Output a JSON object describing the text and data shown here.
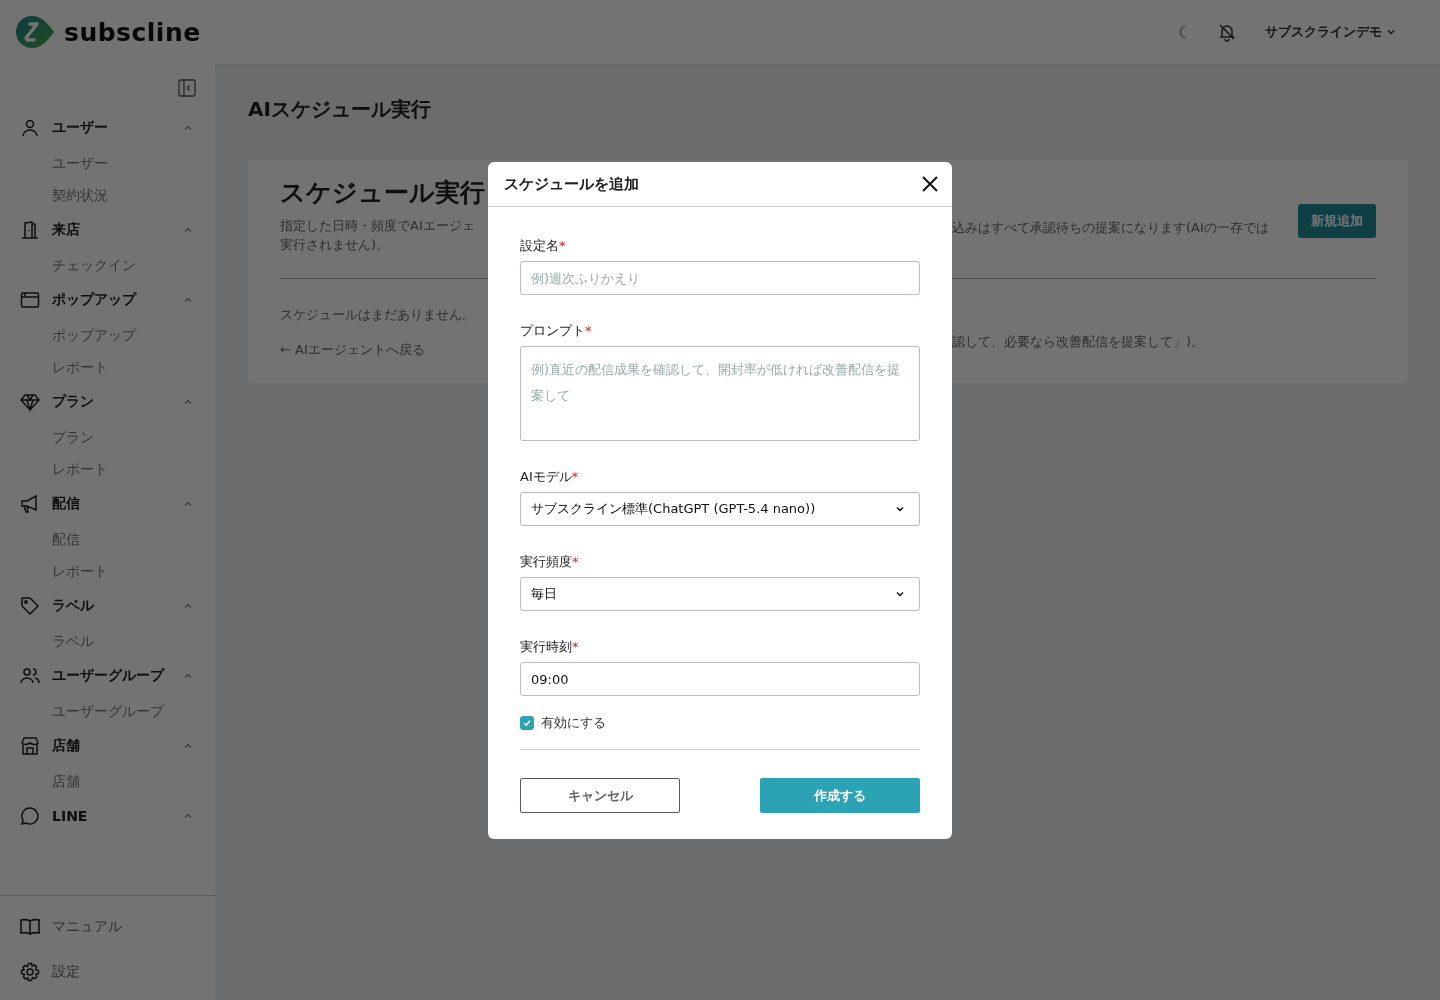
{
  "header": {
    "logo_text": "subscline",
    "account": "サブスクラインデモ"
  },
  "sidebar": {
    "groups": [
      {
        "kind": "user",
        "label": "ユーザー",
        "expanded": true,
        "children": [
          {
            "label": "ユーザー"
          },
          {
            "label": "契約状況"
          }
        ]
      },
      {
        "kind": "store",
        "label": "来店",
        "expanded": true,
        "children": [
          {
            "label": "チェックイン"
          }
        ]
      },
      {
        "kind": "popup",
        "label": "ポップアップ",
        "expanded": true,
        "children": [
          {
            "label": "ポップアップ"
          },
          {
            "label": "レポート"
          }
        ]
      },
      {
        "kind": "plan",
        "label": "プラン",
        "expanded": true,
        "children": [
          {
            "label": "プラン"
          },
          {
            "label": "レポート"
          }
        ]
      },
      {
        "kind": "delivery",
        "label": "配信",
        "expanded": true,
        "children": [
          {
            "label": "配信"
          },
          {
            "label": "レポート"
          }
        ]
      },
      {
        "kind": "label",
        "label": "ラベル",
        "expanded": true,
        "children": [
          {
            "label": "ラベル"
          }
        ]
      },
      {
        "kind": "group",
        "label": "ユーザーグループ",
        "expanded": true,
        "children": [
          {
            "label": "ユーザーグループ"
          }
        ]
      },
      {
        "kind": "shop",
        "label": "店舗",
        "expanded": true,
        "children": [
          {
            "label": "店舗"
          }
        ]
      },
      {
        "kind": "line",
        "label": "LINE",
        "expanded": true
      }
    ],
    "footer": [
      {
        "kind": "manual",
        "label": "マニュアル"
      },
      {
        "kind": "settings",
        "label": "設定"
      }
    ]
  },
  "page": {
    "title": "AIスケジュール実行",
    "card": {
      "title": "スケジュール実行",
      "description_left": [
        "指定した日時・頻度でAIエージェ",
        "実行されません)。"
      ],
      "description_right": "込みはすべて承認待ちの提案になります(AIの一存では",
      "add_button": "新規追加",
      "empty_left": "スケジュールはまだありません。",
      "empty_right": "認して、必要なら改善配信を提案して」)。",
      "back_link": "← AIエージェントへ戻る"
    }
  },
  "modal": {
    "title": "スケジュールを追加",
    "fields": [
      {
        "kind": "text",
        "label": "設定名",
        "mark": "*",
        "placeholder": "例)週次ふりかえり"
      },
      {
        "kind": "textarea",
        "label": "プロンプト",
        "mark": "*",
        "placeholder": "例)直近の配信成果を確認して、開封率が低ければ改善配信を提案して"
      },
      {
        "kind": "select",
        "label": "AIモデル",
        "mark": "*",
        "value": "サブスクライン標準(ChatGPT (GPT-5.4 nano))"
      },
      {
        "kind": "select",
        "label": "実行頻度",
        "mark": "*",
        "value": "毎日"
      },
      {
        "kind": "text",
        "label": "実行時刻",
        "mark": "*",
        "value": "09:00"
      }
    ],
    "checkbox": {
      "label": "有効にする",
      "checked": true
    },
    "cancel_button": "キャンセル",
    "submit_button": "作成する"
  }
}
